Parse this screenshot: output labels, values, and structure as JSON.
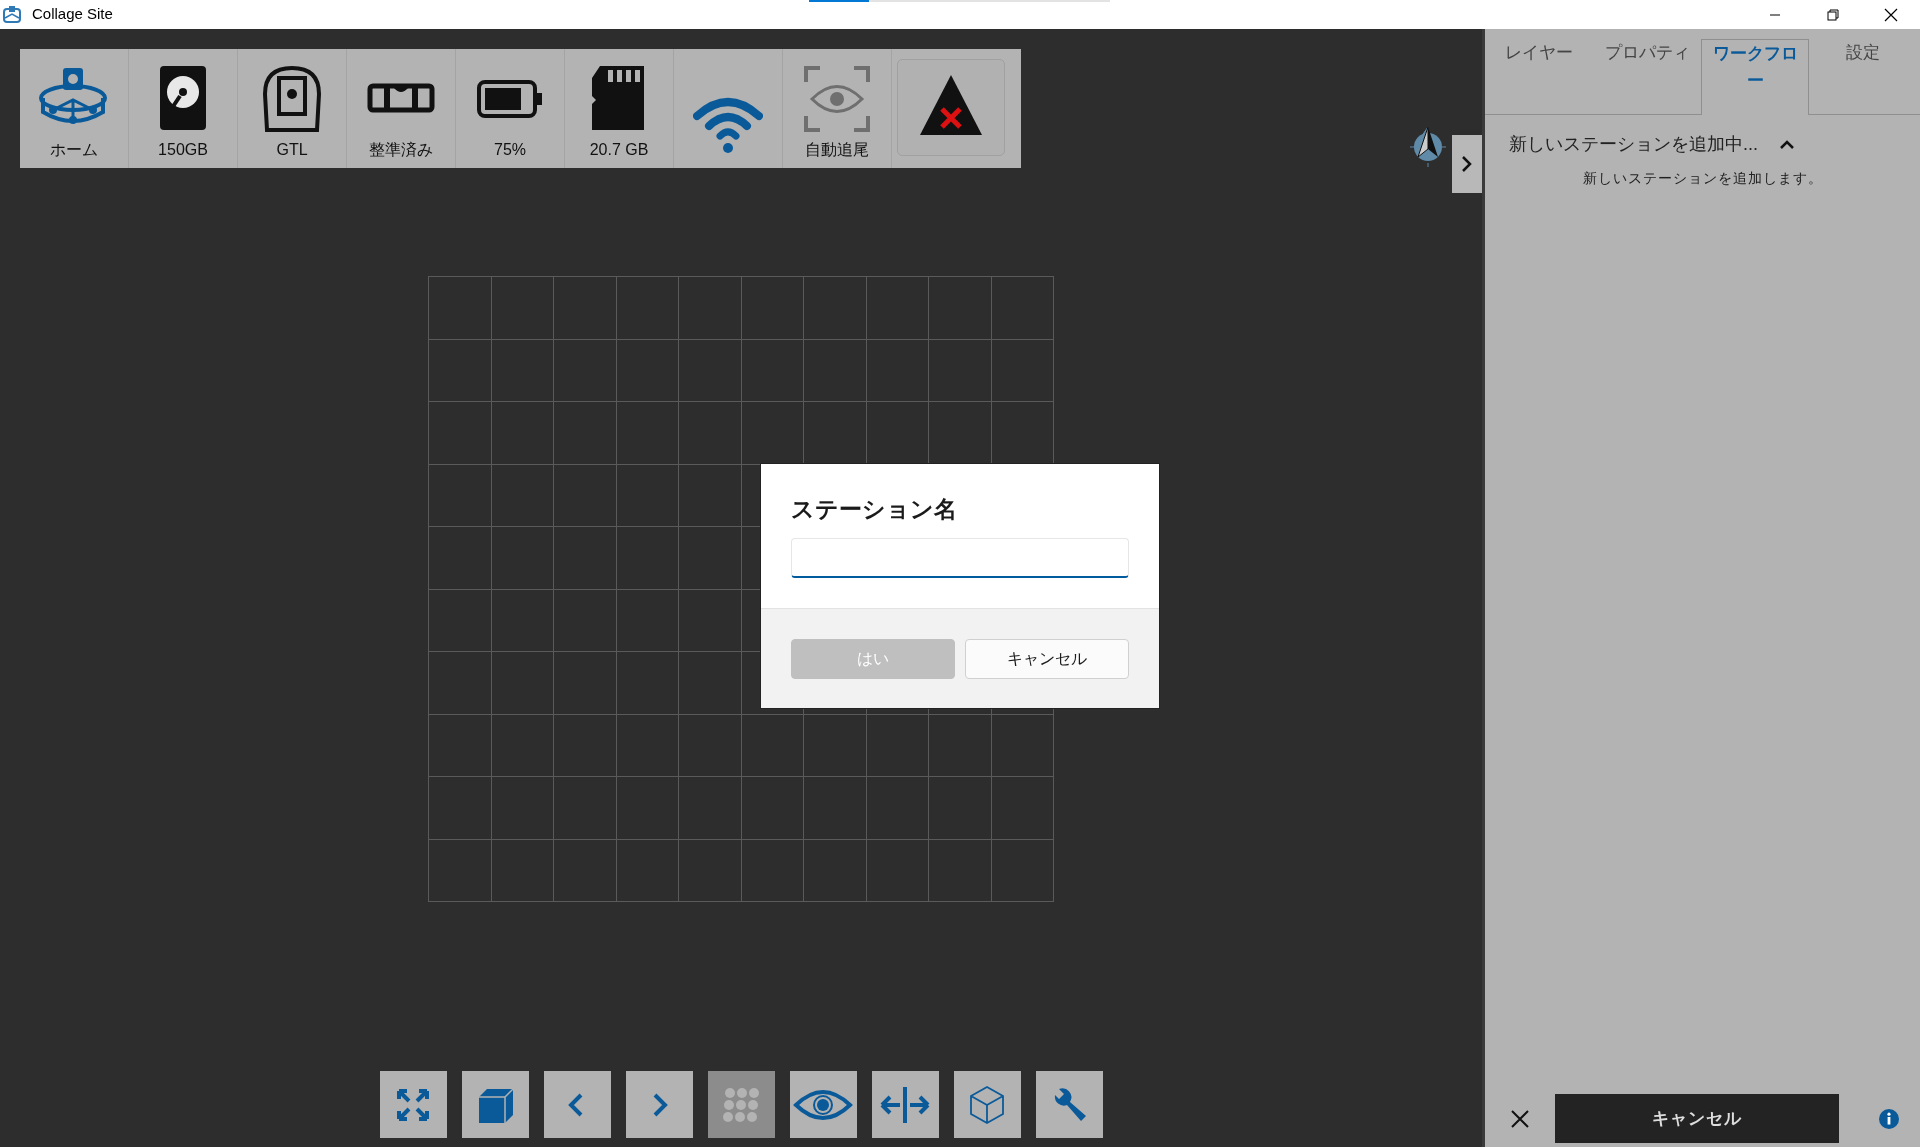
{
  "window": {
    "title": "Collage Site",
    "progress": {
      "level": 0.2
    }
  },
  "toolbar": [
    {
      "kind": "home",
      "label": "ホーム"
    },
    {
      "kind": "disk",
      "label": "150GB"
    },
    {
      "kind": "instrument",
      "label": "GTL"
    },
    {
      "kind": "level",
      "label": "整準済み"
    },
    {
      "kind": "battery",
      "label": "75%"
    },
    {
      "kind": "sdcard",
      "label": "20.7 GB"
    },
    {
      "kind": "wifi"
    },
    {
      "kind": "track",
      "label": "自動追尾"
    },
    {
      "kind": "alert"
    }
  ],
  "dialog": {
    "title": "ステーション名",
    "buttons": [
      {
        "label": "はい",
        "disabled": true
      },
      {
        "label": "キャンセル",
        "disabled": false
      }
    ]
  },
  "bottom_toolbar": [
    {
      "kind": "fit",
      "disabled": false
    },
    {
      "kind": "solid-cube",
      "disabled": false
    },
    {
      "kind": "prev",
      "disabled": false
    },
    {
      "kind": "next",
      "disabled": false
    },
    {
      "kind": "dots",
      "disabled": true
    },
    {
      "kind": "eye",
      "disabled": false
    },
    {
      "kind": "split",
      "disabled": false
    },
    {
      "kind": "wire-cube",
      "disabled": false
    },
    {
      "kind": "wrench",
      "disabled": false
    }
  ],
  "panel": {
    "tabs": [
      {
        "label": "レイヤー",
        "selected": false
      },
      {
        "label": "プロパティ",
        "selected": false
      },
      {
        "label": "ワークフロー",
        "selected": true
      },
      {
        "label": "設定",
        "selected": false
      }
    ],
    "section": {
      "title": "新しいステーションを追加中...",
      "expanded": true,
      "description": "新しいステーションを追加します。"
    },
    "footer": {
      "button": "キャンセル"
    }
  }
}
